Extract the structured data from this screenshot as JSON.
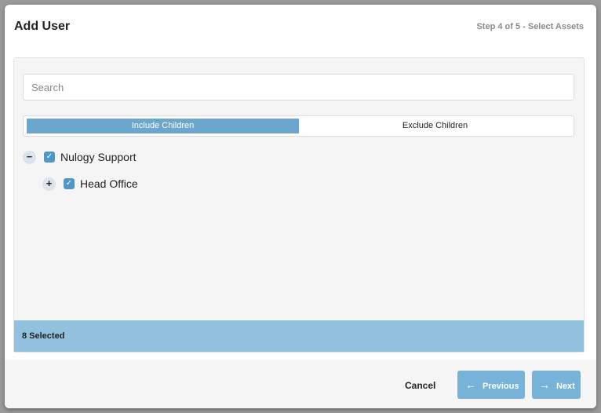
{
  "dialog": {
    "title": "Add User",
    "step": "Step 4 of 5 - Select Assets"
  },
  "search": {
    "placeholder": "Search",
    "value": ""
  },
  "toggle": {
    "include_label": "Include Children",
    "exclude_label": "Exclude Children",
    "selected": "Include Children"
  },
  "tree": {
    "nodes": [
      {
        "label": "Nulogy Support",
        "expander": "−",
        "checked": true
      },
      {
        "label": "Head Office",
        "expander": "+",
        "checked": true
      }
    ]
  },
  "selection": {
    "count_label": "8 Selected"
  },
  "footer": {
    "cancel_label": "Cancel",
    "previous_label": "Previous",
    "next_label": "Next"
  },
  "icons": {
    "check": "check-icon",
    "previous": "arrow-left-icon",
    "next": "arrow-right-icon"
  },
  "colors": {
    "accent": "#6ba6cc",
    "checkbox": "#4f97c9",
    "selected_bar": "#91c1dc",
    "button": "#77b3d8"
  }
}
